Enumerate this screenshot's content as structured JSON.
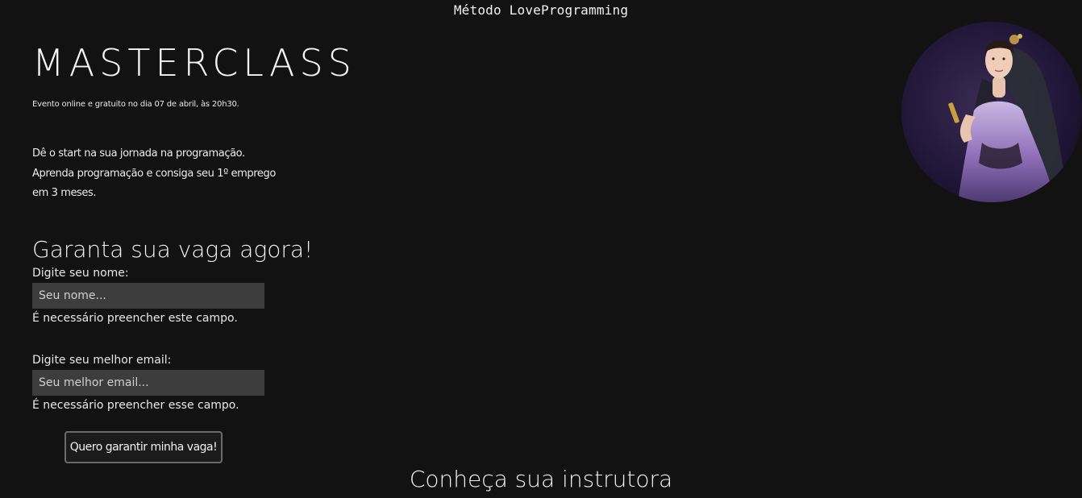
{
  "header": {
    "brand": "Método LoveProgramming"
  },
  "hero": {
    "title": "MASTERCLASS",
    "event_info": "Evento online e gratuito no dia 07 de abril, às 20h30.",
    "pitch_lines": [
      "Dê o start na sua jornada na programação.",
      "Aprenda programação e consiga seu 1º emprego",
      "em 3 meses."
    ]
  },
  "form": {
    "title": "Garanta sua vaga agora!",
    "name_field": {
      "label": "Digite seu nome:",
      "placeholder": "Seu nome...",
      "value": "",
      "error": "É necessário preencher este campo."
    },
    "email_field": {
      "label": "Digite seu melhor email:",
      "placeholder": "Seu melhor email...",
      "value": "",
      "error": "É necessário preencher esse campo."
    },
    "submit_label": "Quero garantir minha vaga!"
  },
  "instructor": {
    "section_title": "Conheça sua instrutora"
  },
  "colors": {
    "background": "#121212",
    "input_background": "#3d3d3d",
    "text": "#ededed",
    "button_border": "#6b6b6b"
  }
}
